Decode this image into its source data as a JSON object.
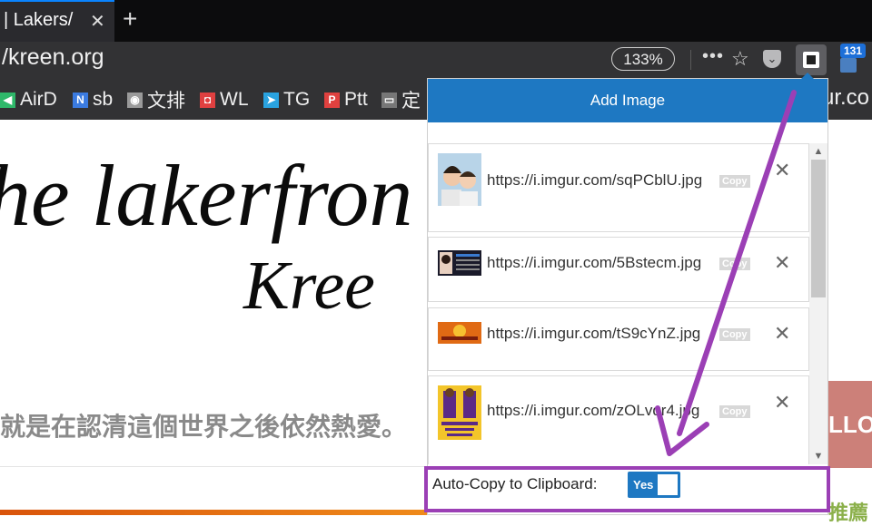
{
  "browser": {
    "tab_title": "| Lakers/",
    "tab_close": "✕",
    "new_tab": "+",
    "url": "/kreen.org",
    "zoom": "133%",
    "page_actions": "•••",
    "bookmark_star": "☆",
    "extension_badge": "131",
    "pocket_glyph": "⌄"
  },
  "bookmarks": [
    {
      "label": "AirD",
      "icon": "airdrop-icon",
      "glyph": "◀",
      "color": "#2fb86a"
    },
    {
      "label": "sb",
      "icon": "n-icon",
      "glyph": "N",
      "color": "#3b7be0"
    },
    {
      "label": "文排",
      "icon": "globe-icon",
      "glyph": "◉",
      "color": "#9a9a9a"
    },
    {
      "label": "WL",
      "icon": "wl-icon",
      "glyph": "◘",
      "color": "#e04040"
    },
    {
      "label": "TG",
      "icon": "telegram-icon",
      "glyph": "➤",
      "color": "#2aa3e0"
    },
    {
      "label": "Ptt",
      "icon": "ptt-icon",
      "glyph": "P",
      "color": "#e0413f"
    },
    {
      "label": "定",
      "icon": "folder-icon",
      "glyph": "▭",
      "color": "#777"
    }
  ],
  "bookmark_overflow": "ur.co",
  "page": {
    "heading_line1": "he lakerfron",
    "heading_line2": "Kree",
    "tagline": "就是在認清這個世界之後依然熱愛。",
    "follow_text": "LLOW",
    "side_text": "推薦"
  },
  "popup": {
    "header": "Add Image",
    "copy_label": "Copy",
    "remove_glyph": "✕",
    "items": [
      {
        "url": "https://i.imgur.com/sqPCblU.jpg"
      },
      {
        "url": "https://i.imgur.com/5Bstecm.jpg"
      },
      {
        "url": "https://i.imgur.com/tS9cYnZ.jpg"
      },
      {
        "url": "https://i.imgur.com/zOLvqr4.jpg"
      }
    ],
    "auto_copy_label": "Auto-Copy to Clipboard:",
    "auto_copy_value": "Yes",
    "scroll_up": "▲",
    "scroll_down": "▼"
  },
  "colors": {
    "accent": "#1e78c2",
    "annotation": "#9b3fb5"
  }
}
